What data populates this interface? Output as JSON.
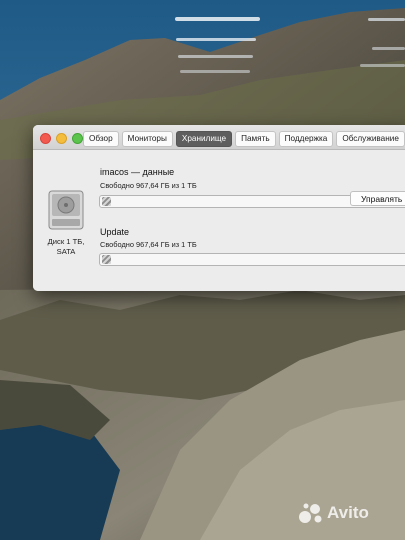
{
  "window": {
    "tabs": [
      {
        "label": "Обзор",
        "active": false
      },
      {
        "label": "Мониторы",
        "active": false
      },
      {
        "label": "Хранилище",
        "active": true
      },
      {
        "label": "Память",
        "active": false
      },
      {
        "label": "Поддержка",
        "active": false
      },
      {
        "label": "Обслуживание",
        "active": false
      }
    ],
    "disk": {
      "icon": "hard-drive-icon",
      "name_line1": "Диск 1 ТБ,",
      "name_line2": "SATA"
    },
    "volumes": [
      {
        "name": "imacos — данные",
        "free": "Свободно 967,64 ГБ из 1 ТБ",
        "used_fraction": 0.03
      },
      {
        "name": "Update",
        "free": "Свободно 967,64 ГБ из 1 ТБ",
        "used_fraction": 0.03
      }
    ],
    "manage_button": "Управлять"
  },
  "watermark": {
    "text": "Avito",
    "icon": "avito-logo-icon"
  },
  "colors": {
    "active_tab": "#5e5e5e",
    "close": "#f25a50",
    "minimize": "#f4bd3b",
    "zoom": "#5bc44c"
  }
}
